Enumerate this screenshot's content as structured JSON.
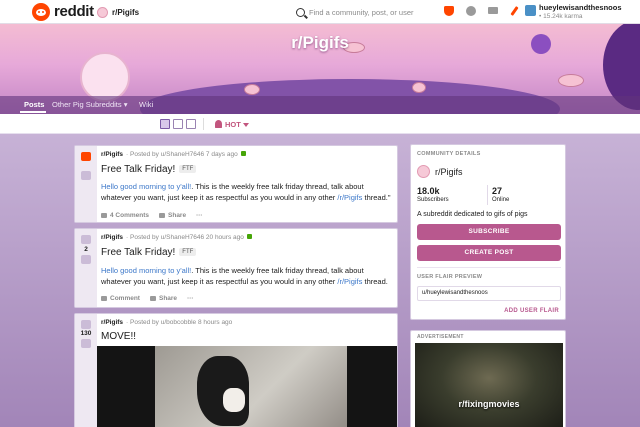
{
  "topnav": {
    "brand": "reddit",
    "subreddit": "r/Pigifs",
    "search_placeholder": "Find a community, post, or user",
    "username": "hueylewisandthesnoos",
    "karma": "15.24k karma"
  },
  "banner": {
    "title": "r/Pigifs",
    "tabs": [
      {
        "label": "Posts"
      },
      {
        "label": "Other Pig Subreddits"
      },
      {
        "label": "Wiki"
      }
    ]
  },
  "sortbar": {
    "sort_label": "HOT"
  },
  "posts": [
    {
      "votes": "",
      "subreddit": "r/Pigifs",
      "meta": "· Posted by u/ShaneH7646 7 days ago",
      "title": "Free Talk Friday!",
      "flair": "FTF",
      "body_blue": "Hello good morning to y'all!",
      "body": ". This is the weekly free talk friday thread, talk about whatever you want, just keep it as respectful as you would in any other ",
      "body_link": "/r/Pigifs",
      "body_end": " thread.\"",
      "comments": "4 Comments",
      "share": "Share",
      "more": "···"
    },
    {
      "votes": "2",
      "subreddit": "r/Pigifs",
      "meta": "· Posted by u/ShaneH7646 20 hours ago",
      "title": "Free Talk Friday!",
      "flair": "FTF",
      "body_blue": "Hello good morning to y'all!",
      "body": ". This is the weekly free talk friday thread, talk about whatever you want, just keep it as respectful as you would in any other ",
      "body_link": "/r/Pigifs",
      "body_end": " thread.",
      "comments": "Comment",
      "share": "Share",
      "more": "···"
    },
    {
      "votes": "130",
      "subreddit": "r/Pigifs",
      "meta": "· Posted by u/bobcobble 8 hours ago",
      "title": "MOVE!!"
    }
  ],
  "sidebar": {
    "heading": "COMMUNITY DETAILS",
    "name": "r/Pigifs",
    "subscribers_count": "18.0k",
    "subscribers_label": "Subscribers",
    "online_count": "27",
    "online_label": "Online",
    "description": "A subreddit dedicated to gifs of pigs",
    "subscribe_button": "SUBSCRIBE",
    "create_post_button": "CREATE POST",
    "flair_heading": "USER FLAIR PREVIEW",
    "flair_value": "u/hueylewisandthesnoos",
    "add_flair": "ADD USER FLAIR"
  },
  "ad": {
    "heading": "ADVERTISEMENT",
    "text": "r/fixingmovies"
  },
  "colors": {
    "brand": "#ff4500",
    "accent": "#b8588e",
    "link": "#3d78c9"
  }
}
